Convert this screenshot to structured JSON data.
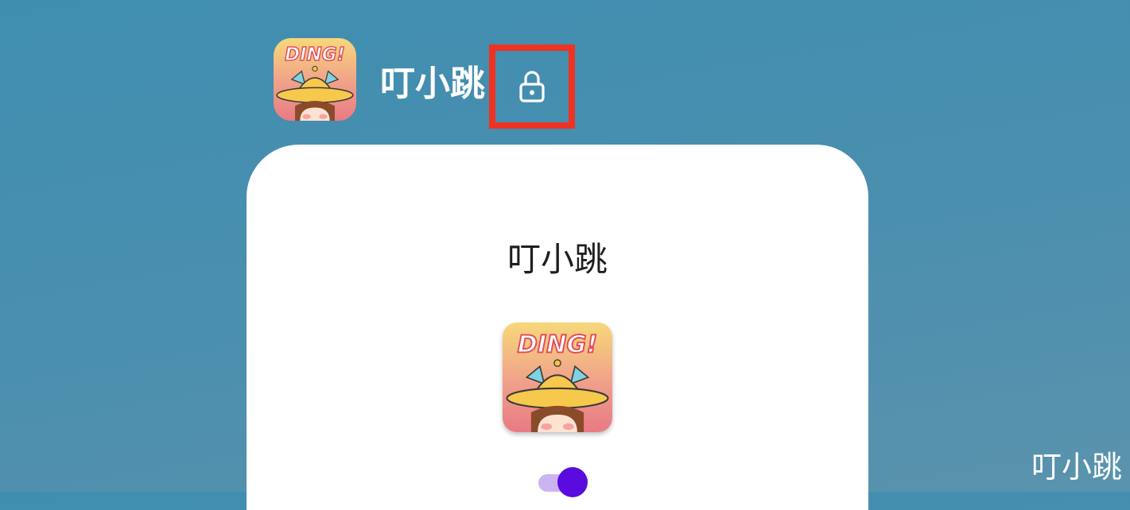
{
  "header": {
    "app_name": "叮小跳",
    "app_icon": "ding-app-icon",
    "lock_icon": "lock-icon"
  },
  "card": {
    "title": "叮小跳",
    "app_icon": "ding-app-icon",
    "toggle": {
      "state": "on",
      "label": ""
    }
  },
  "icon_text": "DING!",
  "watermark": "叮小跳",
  "colors": {
    "background": "#4a90ae",
    "highlight_border": "#ee3322",
    "card_background": "#ffffff",
    "toggle_track": "#cbb4f2",
    "toggle_thumb": "#5a0bde",
    "text_dark": "#1f1f1f",
    "text_light": "#ffffff"
  }
}
